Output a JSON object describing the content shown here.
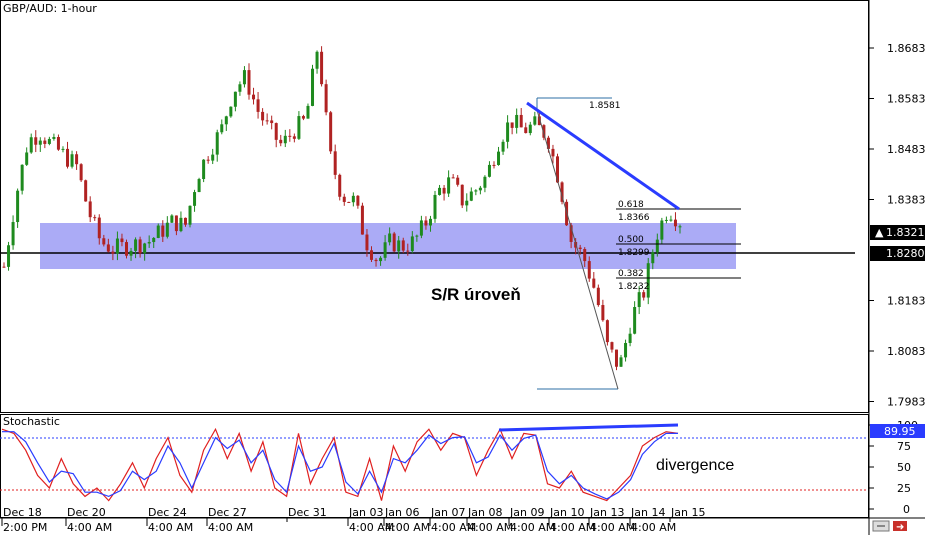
{
  "window": {
    "title": "GBP/AUD: 1-hour",
    "lower_panel_title": "Stochastic"
  },
  "annotations": {
    "sr_label": "S/R úroveň",
    "divergence_label": "divergence",
    "swing_high_label": "1.8581"
  },
  "colors": {
    "bull_candle": "#1e8a1e",
    "bear_candle": "#b02222",
    "sr_zone": "#a7a7f6",
    "trendline": "#2a3cff",
    "stoch_k": "#2a3cff",
    "stoch_d": "#e02020",
    "current_price_bg": "#000000",
    "stoch_badge_bg": "#2a3cff"
  },
  "toolbar": {
    "scroll_icon": "scroll-icon",
    "close_icon": "close-icon"
  },
  "chart_data": [
    {
      "type": "candlestick",
      "title": "GBP/AUD: 1-hour",
      "ylim": [
        1.7983,
        1.8733
      ],
      "price_ticks": [
        "1.8683",
        "1.8583",
        "1.8483",
        "1.8383",
        "1.8183",
        "1.8083",
        "1.7983"
      ],
      "current_price": "1.8321",
      "horizontal_line_price": "1.8280",
      "sr_zone": [
        1.8255,
        1.8345
      ],
      "x_labels": [
        "Dec 18",
        "2:00 PM",
        "Dec 20",
        "4:00 AM",
        "Dec 24",
        "4:00 AM",
        "Dec 27",
        "4:00 AM",
        "Dec 31",
        "Jan 03",
        "4:00 AM",
        "Jan 06",
        "4:00 AM",
        "Jan 07",
        "4:00 AM",
        "Jan 08",
        "4:00 AM",
        "Jan 09",
        "4:00 AM",
        "Jan 10",
        "4:00 AM",
        "Jan 13",
        "4:00 AM",
        "Jan 14",
        "4:00 AM",
        "Jan 15"
      ],
      "close_path": [
        1.825,
        1.839,
        1.85,
        1.8515,
        1.849,
        1.847,
        1.845,
        1.836,
        1.83,
        1.8285,
        1.829,
        1.8295,
        1.83,
        1.832,
        1.834,
        1.833,
        1.843,
        1.848,
        1.852,
        1.86,
        1.8625,
        1.856,
        1.852,
        1.849,
        1.852,
        1.854,
        1.869,
        1.847,
        1.839,
        1.838,
        1.83,
        1.826,
        1.83,
        1.829,
        1.83,
        1.834,
        1.84,
        1.842,
        1.838,
        1.84,
        1.843,
        1.85,
        1.854,
        1.852,
        1.853,
        1.851,
        1.842,
        1.83,
        1.827,
        1.82,
        1.809,
        1.805,
        1.815,
        1.82,
        1.831,
        1.8366,
        1.834
      ],
      "fibonacci": {
        "high": 1.8581,
        "low": 1.8043,
        "levels": [
          {
            "ratio": "0.618",
            "price": "1.8366"
          },
          {
            "ratio": "0.500",
            "price": "1.8299"
          },
          {
            "ratio": "0.382",
            "price": "1.8232"
          }
        ]
      },
      "trendline": {
        "from_price": 1.8575,
        "to_price": 1.837
      }
    },
    {
      "type": "line",
      "title": "Stochastic",
      "ylim": [
        0,
        100
      ],
      "y_ticks": [
        "100",
        "75",
        "50",
        "25",
        "0"
      ],
      "current_value": "89.95",
      "overbought": 80,
      "oversold": 20,
      "series": [
        {
          "values": [
            95,
            90,
            70,
            40,
            25,
            60,
            30,
            15,
            25,
            10,
            30,
            55,
            25,
            60,
            85,
            40,
            20,
            70,
            95,
            60,
            90,
            45,
            80,
            25,
            15,
            90,
            30,
            60,
            85,
            20,
            15,
            60,
            10,
            75,
            45,
            80,
            95,
            70,
            90,
            85,
            40,
            70,
            95,
            60,
            90,
            88,
            30,
            25,
            45,
            20,
            15,
            10,
            25,
            40,
            75,
            85,
            92,
            90
          ]
        },
        {
          "values": [
            92,
            92,
            80,
            55,
            32,
            45,
            42,
            20,
            20,
            15,
            22,
            45,
            35,
            45,
            75,
            55,
            25,
            55,
            85,
            72,
            82,
            55,
            70,
            35,
            20,
            75,
            45,
            50,
            78,
            32,
            18,
            45,
            20,
            60,
            55,
            70,
            88,
            78,
            85,
            86,
            55,
            62,
            88,
            70,
            84,
            88,
            45,
            30,
            40,
            25,
            18,
            12,
            20,
            35,
            65,
            80,
            90,
            90
          ]
        }
      ],
      "divergence_line": {
        "from_value": 93,
        "to_value": 96
      }
    }
  ]
}
